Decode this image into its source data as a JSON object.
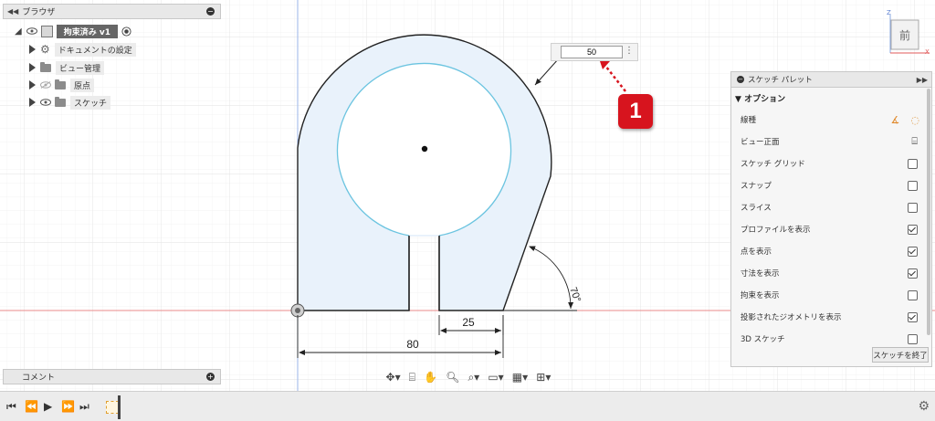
{
  "browser": {
    "title": "ブラウザ",
    "root_label": "拘束済み v1",
    "items": [
      {
        "label": "ドキュメントの設定"
      },
      {
        "label": "ビュー管理"
      },
      {
        "label": "原点"
      },
      {
        "label": "スケッチ"
      }
    ]
  },
  "comment": {
    "title": "コメント"
  },
  "dimension_input": {
    "value": "50"
  },
  "badge": {
    "number": "1"
  },
  "view_cube": {
    "face_label": "前"
  },
  "sketch": {
    "dim_width": "80",
    "dim_slot": "25",
    "dim_angle": "70°"
  },
  "palette": {
    "title": "スケッチ パレット",
    "section": "オプション",
    "rows": [
      {
        "label": "線種",
        "control": "icons"
      },
      {
        "label": "ビュー正面",
        "control": "icon"
      },
      {
        "label": "スケッチ グリッド",
        "control": "checkbox",
        "checked": false
      },
      {
        "label": "スナップ",
        "control": "checkbox",
        "checked": false
      },
      {
        "label": "スライス",
        "control": "checkbox",
        "checked": false
      },
      {
        "label": "プロファイルを表示",
        "control": "checkbox",
        "checked": true
      },
      {
        "label": "点を表示",
        "control": "checkbox",
        "checked": true
      },
      {
        "label": "寸法を表示",
        "control": "checkbox",
        "checked": true
      },
      {
        "label": "拘束を表示",
        "control": "checkbox",
        "checked": false
      },
      {
        "label": "投影されたジオメトリを表示",
        "control": "checkbox",
        "checked": true
      },
      {
        "label": "3D スケッチ",
        "control": "checkbox",
        "checked": false
      }
    ],
    "finish_label": "スケッチを終了"
  },
  "colors": {
    "accent_red": "#d7141e",
    "profile_fill": "#e9f2fb",
    "circle": "#6bc4e0",
    "axis_red": "#e05a5a",
    "axis_blue": "#8aa8e0"
  }
}
